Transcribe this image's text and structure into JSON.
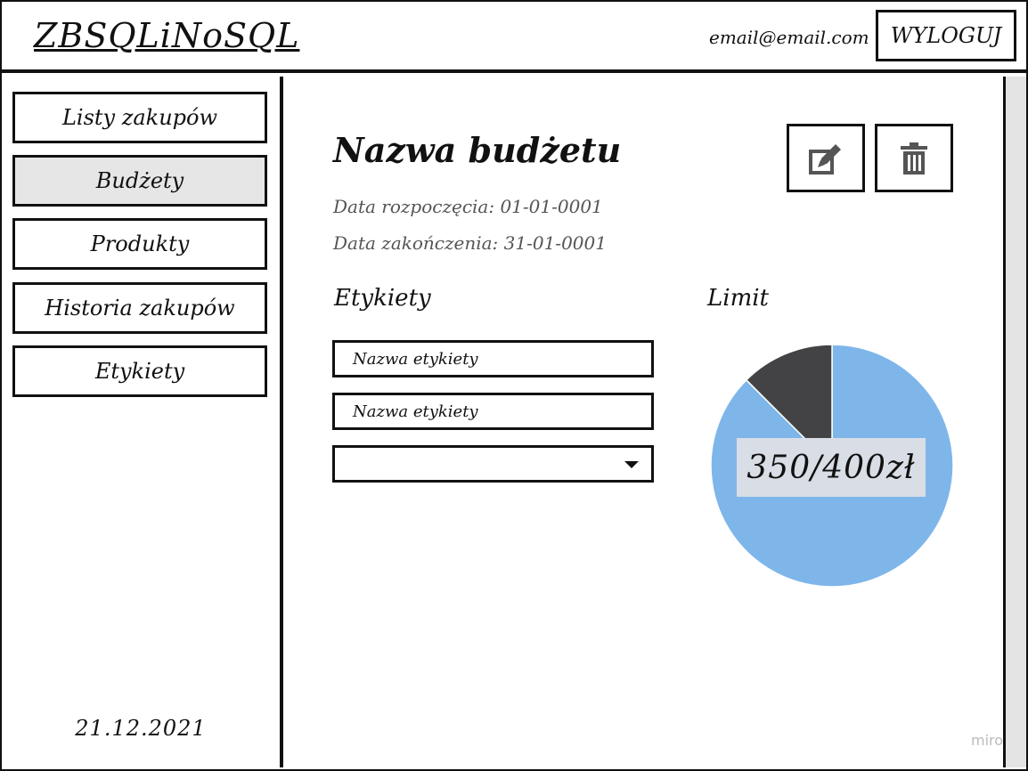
{
  "header": {
    "app_title": "ZBSQLiNoSQL",
    "user_email": "email@email.com",
    "logout_label": "WYLOGUJ"
  },
  "sidebar": {
    "items": [
      {
        "label": "Listy zakupów",
        "active": false
      },
      {
        "label": "Budżety",
        "active": true
      },
      {
        "label": "Produkty",
        "active": false
      },
      {
        "label": "Historia zakupów",
        "active": false
      },
      {
        "label": "Etykiety",
        "active": false
      }
    ],
    "date": "21.12.2021"
  },
  "budget": {
    "name": "Nazwa budżetu",
    "start_date": "Data rozpoczęcia: 01-01-0001",
    "end_date": "Data zakończenia: 31-01-0001",
    "actions": {
      "edit_icon": "edit-icon",
      "delete_icon": "trash-icon"
    }
  },
  "tags": {
    "title": "Etykiety",
    "items": [
      "Nazwa etykiety",
      "Nazwa etykiety"
    ],
    "select_value": ""
  },
  "limit": {
    "title": "Limit",
    "label": "350/400zł"
  },
  "chart_data": {
    "type": "pie",
    "title": "Limit",
    "values": [
      350,
      50
    ],
    "colors": [
      "#7eb6ea",
      "#434346"
    ],
    "label": "350/400zł"
  },
  "watermark": "miro"
}
